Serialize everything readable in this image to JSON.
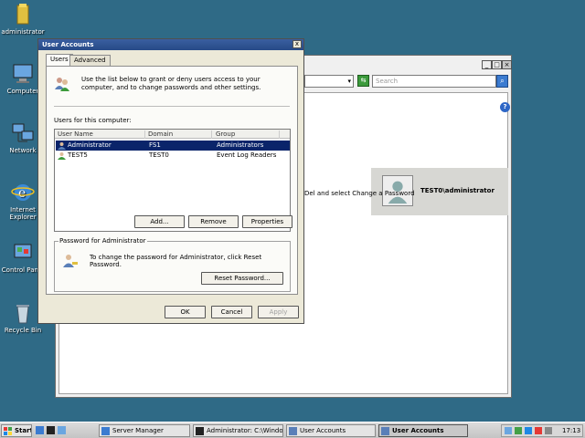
{
  "desktop": {
    "icons": [
      {
        "label": "administrator"
      },
      {
        "label": "Computer"
      },
      {
        "label": "Network"
      },
      {
        "label": "Internet Explorer"
      },
      {
        "label": "Control Panel"
      },
      {
        "label": "Recycle Bin"
      }
    ]
  },
  "bg_window": {
    "search_placeholder": "Search",
    "user_name": "TEST0\\administrator",
    "text_fragment": "Del and select Change a Password",
    "help": "?"
  },
  "dialog": {
    "title": "User Accounts",
    "close": "x",
    "tabs": [
      {
        "label": "Users",
        "selected": true
      },
      {
        "label": "Advanced",
        "selected": false
      }
    ],
    "intro": "Use the list below to grant or deny users access to your computer, and to change passwords and other settings.",
    "users_heading": "Users for this computer:",
    "columns": [
      "User Name",
      "Domain",
      "Group"
    ],
    "rows": [
      {
        "name": "Administrator",
        "domain": "FS1",
        "group": "Administrators",
        "selected": true
      },
      {
        "name": "TEST5",
        "domain": "TEST0",
        "group": "Event Log Readers",
        "selected": false
      }
    ],
    "buttons": {
      "add": "Add...",
      "remove": "Remove",
      "properties": "Properties"
    },
    "password_group_label": "Password for Administrator",
    "password_text": "To change the password for Administrator, click Reset Password.",
    "reset_password": "Reset Password...",
    "ok": "OK",
    "cancel": "Cancel",
    "apply": "Apply"
  },
  "taskbar": {
    "start": "Start",
    "items": [
      {
        "label": "Server Manager"
      },
      {
        "label": "Administrator: C:\\Windo..."
      },
      {
        "label": "User Accounts"
      },
      {
        "label": "User Accounts",
        "active": true
      }
    ],
    "clock": "17:13"
  },
  "colors": {
    "desktop": "#2f6a86",
    "selection": "#0a246a",
    "title_bar": "#274a87"
  }
}
